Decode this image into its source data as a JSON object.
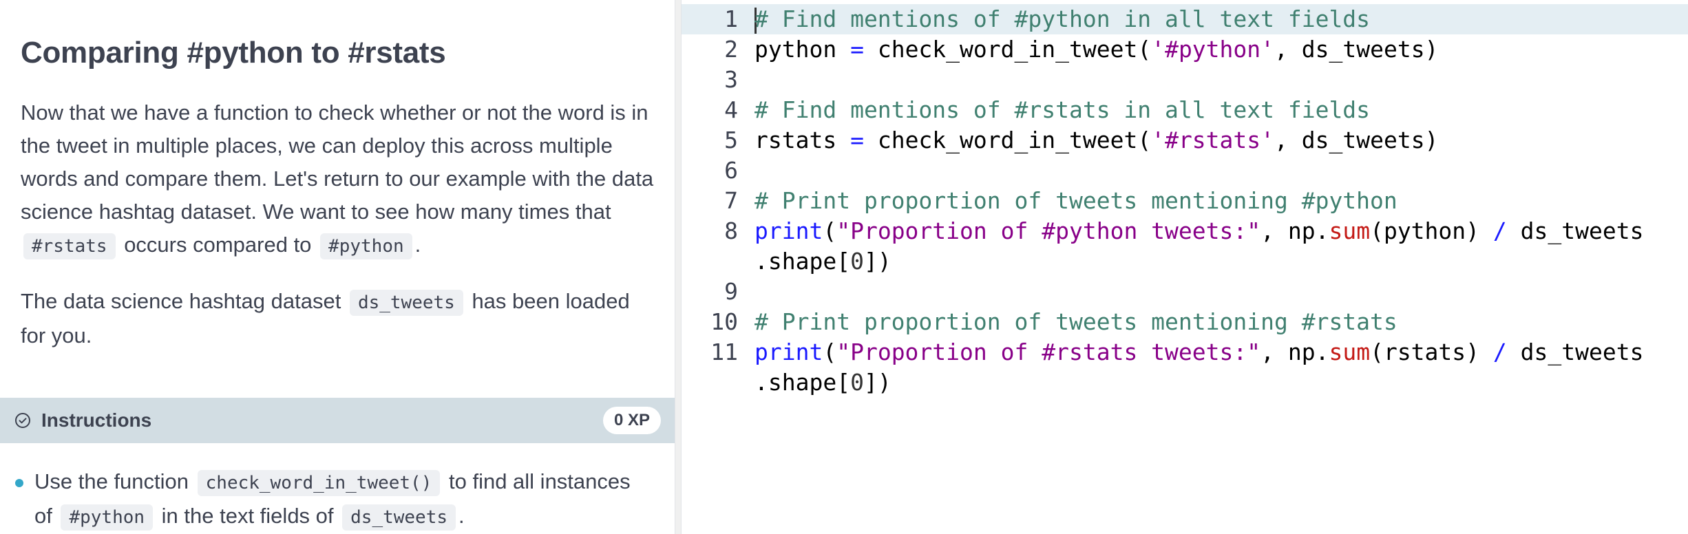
{
  "lesson": {
    "title": "Comparing #python to #rstats",
    "para1": {
      "t1": "Now that we have a function to check whether or not the word is in the tweet in multiple places, we can deploy this across multiple words and compare them. Let's return to our example with the data science hashtag dataset. We want to see how many times that ",
      "code1": "#rstats",
      "t2": " occurs compared to ",
      "code2": "#python",
      "t3": "."
    },
    "para2": {
      "t1": "The data science hashtag dataset ",
      "code1": "ds_tweets",
      "t2": " has been loaded for you."
    }
  },
  "instructions": {
    "label": "Instructions",
    "xp": "0 XP",
    "icon": "check-circle-icon",
    "items": [
      {
        "t1": "Use the function ",
        "code1": "check_word_in_tweet()",
        "t2": " to find all instances of ",
        "code2": "#python",
        "t3": " in the text fields of ",
        "code3": "ds_tweets",
        "t4": "."
      }
    ]
  },
  "editor": {
    "lines": [
      {
        "num": "1",
        "comment": "# Find mentions of #python in all text fields"
      },
      {
        "num": "2",
        "var": "python",
        "eq": " = ",
        "fn": "check_word_in_tweet",
        "p1": "(",
        "str": "'#python'",
        "rest": ", ds_tweets)"
      },
      {
        "num": "3"
      },
      {
        "num": "4",
        "comment": "# Find mentions of #rstats in all text fields"
      },
      {
        "num": "5",
        "var": "rstats",
        "eq": " = ",
        "fn": "check_word_in_tweet",
        "p1": "(",
        "str": "'#rstats'",
        "rest": ", ds_tweets)"
      },
      {
        "num": "6"
      },
      {
        "num": "7",
        "comment": "# Print proportion of tweets mentioning #python"
      },
      {
        "num": "8",
        "kw": "print",
        "p1": "(",
        "str": "\"Proportion of #python tweets:\"",
        "a": ", np.",
        "fn": "sum",
        "b": "(python) ",
        "op": "/",
        "c": " ds_tweets",
        "cont1": ".shape[",
        "n": "0",
        "cont2": "])"
      },
      {
        "num": "9"
      },
      {
        "num": "10",
        "comment": "# Print proportion of tweets mentioning #rstats"
      },
      {
        "num": "11",
        "kw": "print",
        "p1": "(",
        "str": "\"Proportion of #rstats tweets:\"",
        "a": ", np.",
        "fn": "sum",
        "b": "(rstats) ",
        "op": "/",
        "c": " ds_tweets",
        "cont1": ".shape[",
        "n": "0",
        "cont2": "])"
      }
    ]
  },
  "colors": {
    "instructions_bar": "#d2dde3",
    "bullet": "#33a7c9",
    "comment": "#408070",
    "string": "#880088",
    "builtin": "#1a1aff",
    "function": "#c41a16"
  }
}
